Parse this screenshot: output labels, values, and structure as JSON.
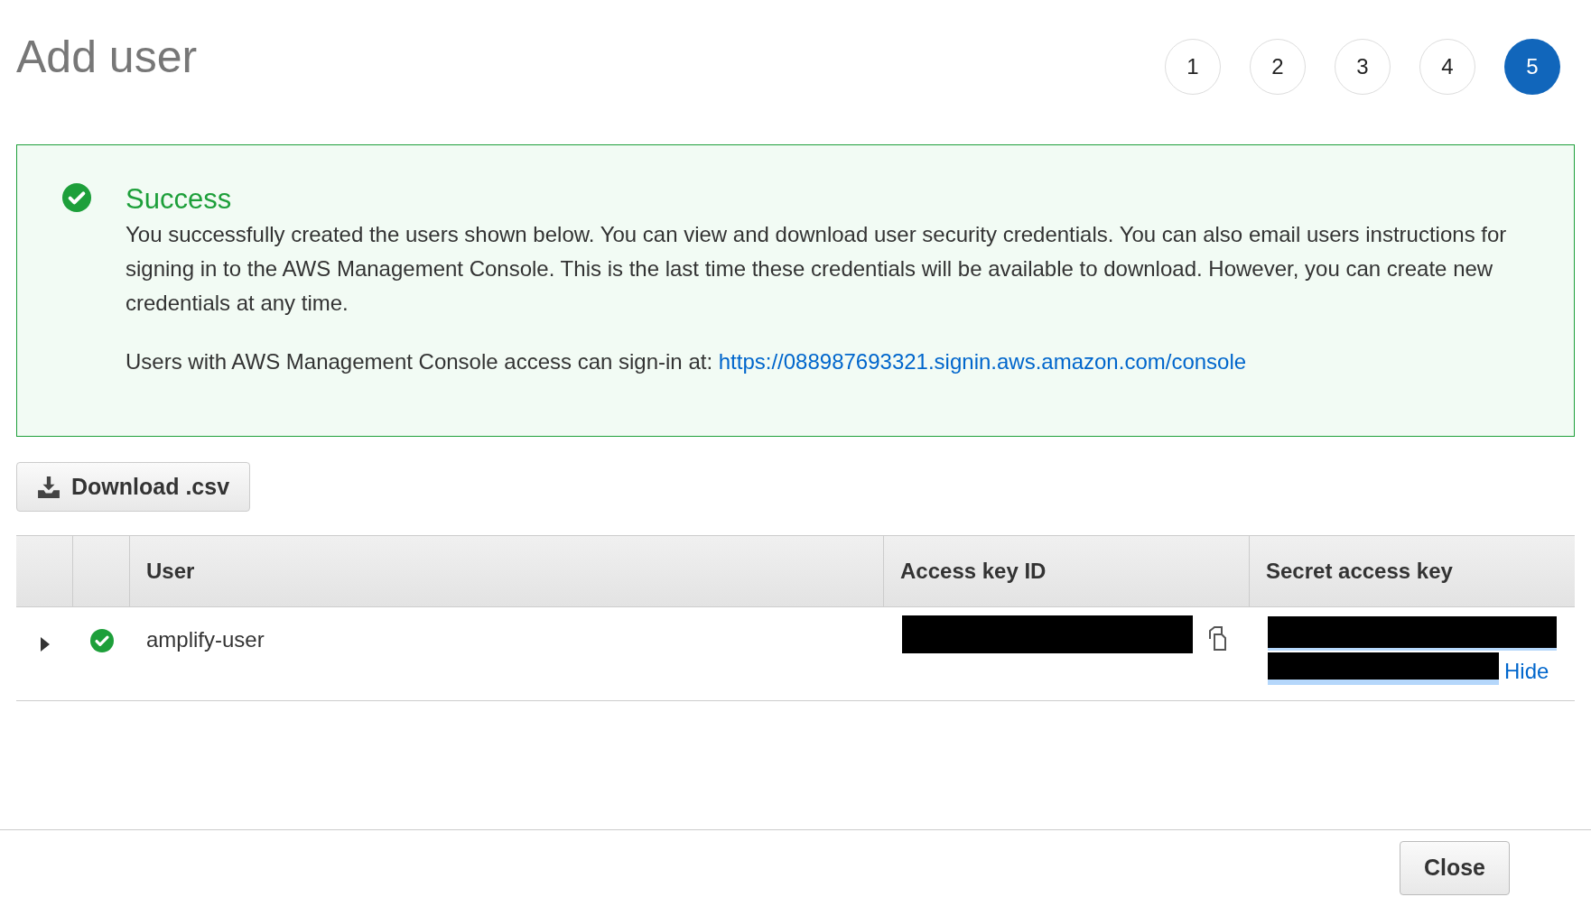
{
  "title": "Add user",
  "steps": [
    {
      "label": "1",
      "selected": false
    },
    {
      "label": "2",
      "selected": false
    },
    {
      "label": "3",
      "selected": false
    },
    {
      "label": "4",
      "selected": false
    },
    {
      "label": "5",
      "selected": true
    }
  ],
  "alert": {
    "title": "Success",
    "message": "You successfully created the users shown below. You can view and download user security credentials. You can also email users instructions for signing in to the AWS Management Console. This is the last time these credentials will be available to download. However, you can create new credentials at any time.",
    "signin_text": "Users with AWS Management Console access can sign-in at:",
    "signin_link": "https://088987693321.signin.aws.amazon.com/console"
  },
  "download_button": "Download .csv",
  "table": {
    "columns": [
      "User",
      "Access key ID",
      "Secret access key"
    ],
    "rows": [
      {
        "user": "amplify-user",
        "expanded": false,
        "secret_action": "Hide"
      }
    ]
  },
  "footer": {
    "close_button": "Close"
  }
}
